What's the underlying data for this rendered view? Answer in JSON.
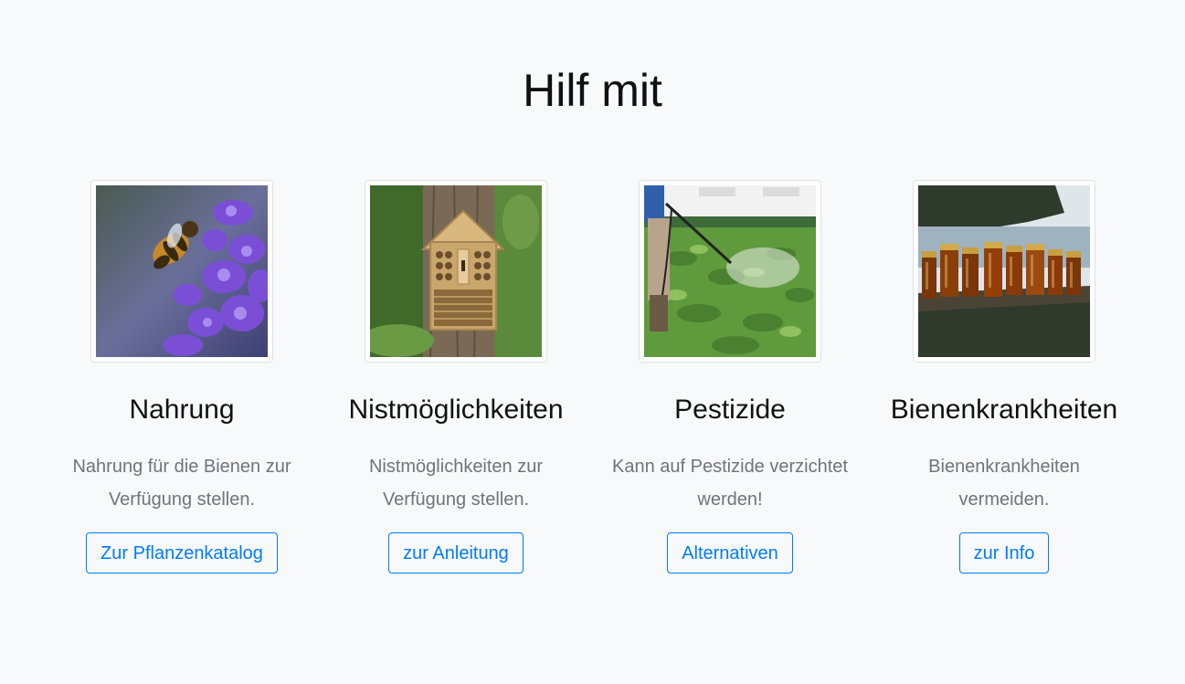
{
  "page": {
    "title": "Hilf mit"
  },
  "cards": [
    {
      "title": "Nahrung",
      "text": "Nahrung für die Bienen zur Verfügung stellen.",
      "button": "Zur Pflanzenkatalog",
      "image": "bee-on-lavender-photo"
    },
    {
      "title": "Nistmöglichkeiten",
      "text": "Nistmöglichkeiten zur Verfügung stellen.",
      "button": "zur Anleitung",
      "image": "insect-hotel-photo"
    },
    {
      "title": "Pestizide",
      "text": "Kann auf Pestizide verzichtet werden!",
      "button": "Alternativen",
      "image": "pesticide-spraying-photo"
    },
    {
      "title": "Bienenkrankheiten",
      "text": "Bienenkrankheiten vermeiden.",
      "button": "zur Info",
      "image": "honey-jars-photo"
    }
  ],
  "colors": {
    "background": "#f8f9fa",
    "button_accent": "#007bff",
    "muted_text": "#6c757d"
  }
}
